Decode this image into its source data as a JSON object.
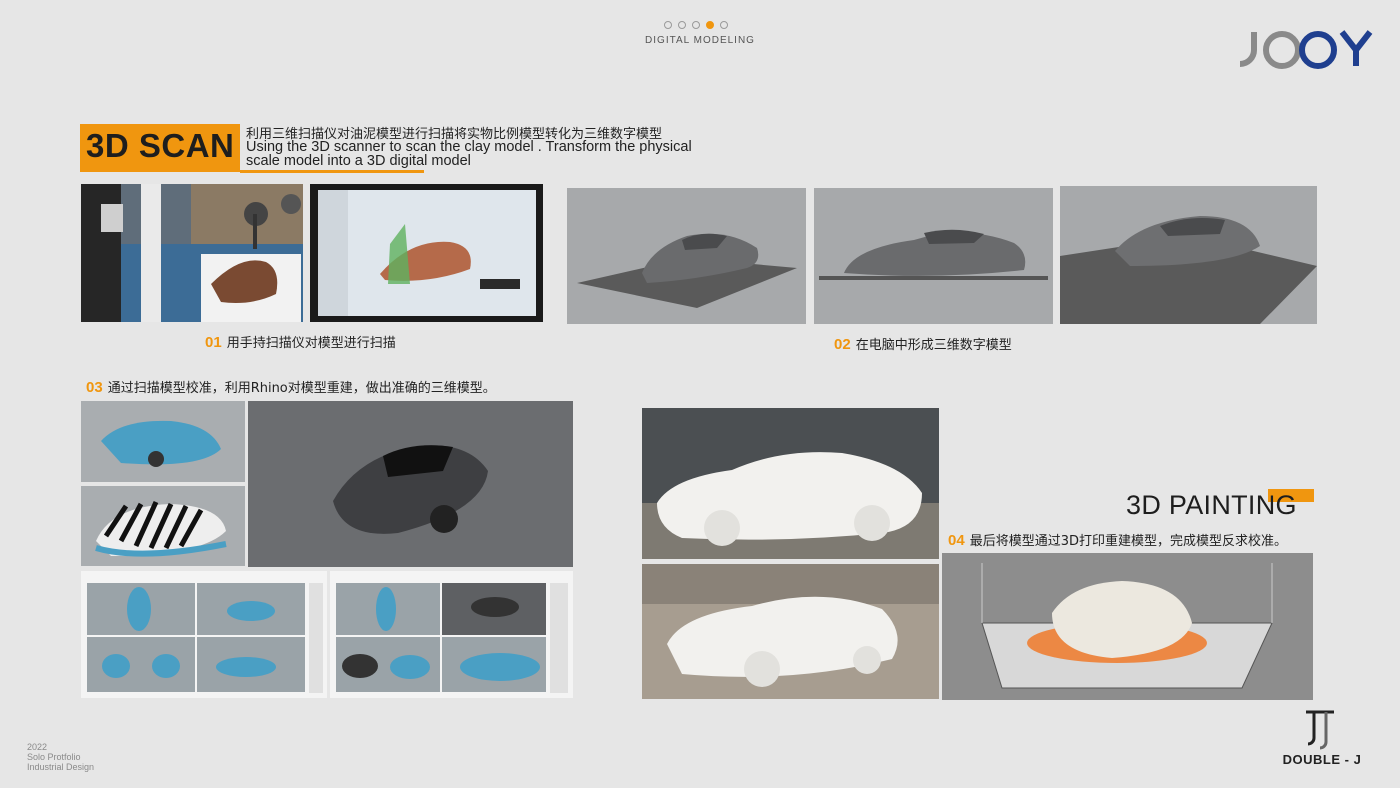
{
  "header": {
    "section_title": "DIGITAL MODELING",
    "progress": {
      "total": 5,
      "current": 4
    },
    "brand_logo": "JOOY"
  },
  "scan": {
    "title": "3D SCAN",
    "description_cn": "利用三维扫描仪对油泥模型进行扫描将实物比例模型转化为三维数字模型",
    "description_en_line1": "Using the 3D scanner to scan the clay model . Transform the physical",
    "description_en_line2": "scale model into a 3D digital model"
  },
  "steps": [
    {
      "num": "01",
      "text": "用手持扫描仪对模型进行扫描"
    },
    {
      "num": "02",
      "text": "在电脑中形成三维数字模型"
    },
    {
      "num": "03",
      "text": "通过扫描模型校准，利用Rhino对模型重建，做出准确的三维模型。"
    },
    {
      "num": "04",
      "text": "最后将模型通过3D打印重建模型，完成模型反求校准。"
    }
  ],
  "painting": {
    "title": "3D PAINTING"
  },
  "footer": {
    "year": "2022",
    "line2": "Solo Protfolio",
    "line3": "Industrial Design",
    "brand": "DOUBLE - J"
  },
  "colors": {
    "accent": "#f0960f",
    "background": "#e6e6e6",
    "logo_blue": "#1f3f8f"
  }
}
